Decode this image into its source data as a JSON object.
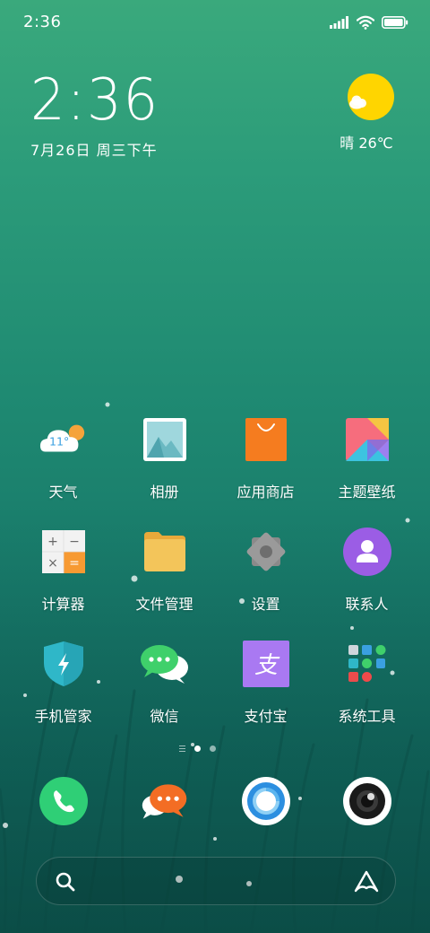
{
  "status_bar": {
    "time": "2:36",
    "signal_icon": "signal-bars-icon",
    "wifi_icon": "wifi-icon",
    "battery_icon": "battery-icon",
    "battery_level": 1.0
  },
  "clock_widget": {
    "time": "2:36",
    "date": "7月26日 周三下午"
  },
  "weather_widget": {
    "icon": "sun-with-cloud-icon",
    "text": "晴 26℃"
  },
  "apps": [
    {
      "label": "天气",
      "icon": "weather-icon",
      "badge": "11°"
    },
    {
      "label": "相册",
      "icon": "gallery-icon"
    },
    {
      "label": "应用商店",
      "icon": "app-store-icon"
    },
    {
      "label": "主题壁纸",
      "icon": "themes-icon"
    },
    {
      "label": "计算器",
      "icon": "calculator-icon",
      "keys": [
        "+",
        "−",
        "×",
        "="
      ]
    },
    {
      "label": "文件管理",
      "icon": "folder-icon"
    },
    {
      "label": "设置",
      "icon": "settings-icon"
    },
    {
      "label": "联系人",
      "icon": "contacts-icon"
    },
    {
      "label": "手机管家",
      "icon": "security-shield-icon"
    },
    {
      "label": "微信",
      "icon": "wechat-icon"
    },
    {
      "label": "支付宝",
      "icon": "alipay-icon",
      "glyph": "支"
    },
    {
      "label": "系统工具",
      "icon": "system-tools-folder-icon"
    }
  ],
  "page_indicator": {
    "pages": 2,
    "current_page": 1
  },
  "dock": [
    {
      "icon": "phone-icon"
    },
    {
      "icon": "messages-icon"
    },
    {
      "icon": "browser-icon"
    },
    {
      "icon": "camera-icon"
    }
  ],
  "search_bar": {
    "search_icon": "search-icon",
    "assistant_icon": "assistant-icon"
  },
  "colors": {
    "accent_orange": "#f57c1f",
    "wechat_green": "#3fd06b",
    "phone_green": "#2fcf76",
    "contacts_purple": "#9b5de5",
    "alipay_purple": "#a979f2",
    "weather_sun": "#ffd500"
  }
}
